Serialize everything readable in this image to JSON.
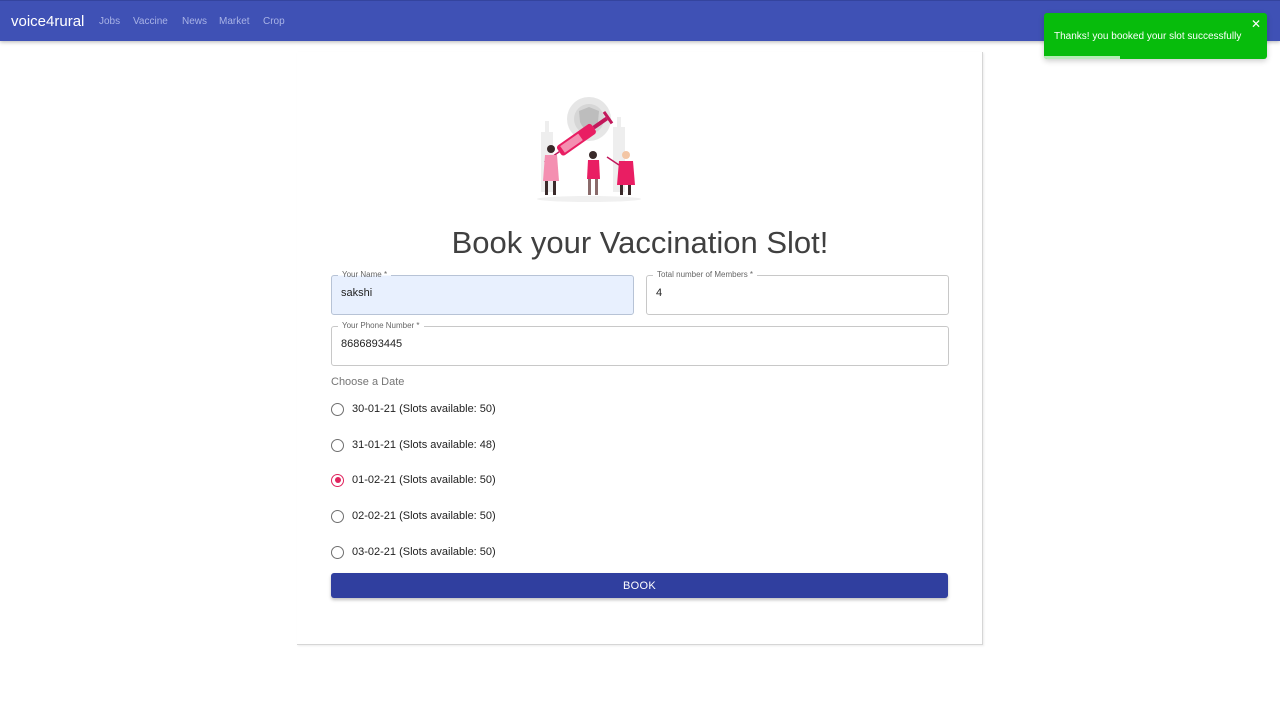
{
  "nav": {
    "brand": "voice4rural",
    "links": [
      "Jobs",
      "Vaccine",
      "News",
      "Market",
      "Crop"
    ]
  },
  "form": {
    "title": "Book your Vaccination Slot!",
    "name_label": "Your Name *",
    "name_value": "sakshi",
    "members_label": "Total number of Members *",
    "members_value": "4",
    "phone_label": "Your Phone Number *",
    "phone_value": "8686893445",
    "date_heading": "Choose a Date",
    "dates": [
      {
        "label": "30-01-21 (Slots available: 50)",
        "checked": false
      },
      {
        "label": "31-01-21 (Slots available: 48)",
        "checked": false
      },
      {
        "label": "01-02-21 (Slots available: 50)",
        "checked": true
      },
      {
        "label": "02-02-21 (Slots available: 50)",
        "checked": false
      },
      {
        "label": "03-02-21 (Slots available: 50)",
        "checked": false
      }
    ],
    "book_label": "BOOK"
  },
  "toast": {
    "message": "Thanks! you booked your slot successfully",
    "close_icon": "close-icon",
    "progress": 0.34
  },
  "colors": {
    "navbar": "#3f51b5",
    "button": "#303f9f",
    "toast": "#07bc0c",
    "radio_accent": "#e0245e"
  }
}
